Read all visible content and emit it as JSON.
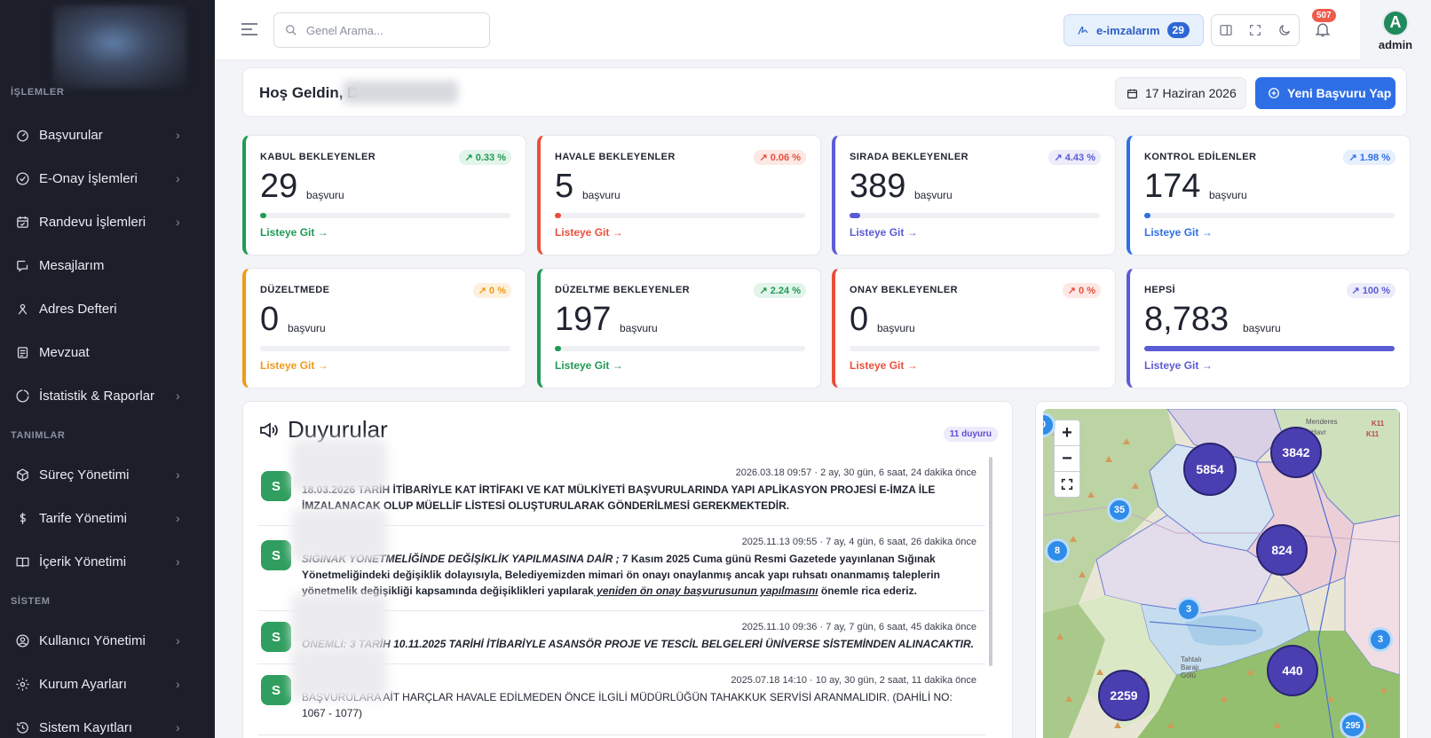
{
  "sidebar": {
    "sections": [
      "İŞLEMLER",
      "TANIMLAR",
      "SİSTEM"
    ],
    "items": [
      {
        "label": "Başvurular",
        "icon": "gauge-icon"
      },
      {
        "label": "E-Onay İşlemleri",
        "icon": "check-circle-icon"
      },
      {
        "label": "Randevu İşlemleri",
        "icon": "calendar-check-icon"
      },
      {
        "label": "Mesajlarım",
        "icon": "message-icon"
      },
      {
        "label": "Adres Defteri",
        "icon": "address-book-icon"
      },
      {
        "label": "Mevzuat",
        "icon": "document-icon"
      },
      {
        "label": "İstatistik & Raporlar",
        "icon": "chart-ring-icon"
      },
      {
        "label": "Süreç Yönetimi",
        "icon": "cube-icon"
      },
      {
        "label": "Tarife Yönetimi",
        "icon": "dollar-icon"
      },
      {
        "label": "İçerik Yönetimi",
        "icon": "book-icon"
      },
      {
        "label": "Kullanıcı Yönetimi",
        "icon": "user-circle-icon"
      },
      {
        "label": "Kurum Ayarları",
        "icon": "gear-icon"
      },
      {
        "label": "Sistem Kayıtları",
        "icon": "history-icon"
      }
    ]
  },
  "topbar": {
    "search_placeholder": "Genel Arama...",
    "eimza_label": "e-imzalarım",
    "eimza_count": "29",
    "notif_count": "507",
    "avatar_letter": "A",
    "user_name": "admin"
  },
  "welcome": {
    "greeting": "Hoş Geldin, B",
    "date": "17 Haziran 2026",
    "new_button": "Yeni Başvuru Yap"
  },
  "stats": [
    {
      "title": "KABUL BEKLEYENLER",
      "value": "29",
      "unit": "başvuru",
      "change": "0.33 %",
      "progress": 0.0033,
      "link": "Listeye Git",
      "color": "#1f9a55",
      "badge_bg": "#e3f5ea"
    },
    {
      "title": "HAVALE BEKLEYENLER",
      "value": "5",
      "unit": "başvuru",
      "change": "0.06 %",
      "progress": 0.0006,
      "link": "Listeye Git",
      "color": "#ea4f3c",
      "badge_bg": "#fde8e5"
    },
    {
      "title": "SIRADA BEKLEYENLER",
      "value": "389",
      "unit": "başvuru",
      "change": "4.43 %",
      "progress": 0.0443,
      "link": "Listeye Git",
      "color": "#5b5bd6",
      "badge_bg": "#ececfb"
    },
    {
      "title": "KONTROL EDİLENLER",
      "value": "174",
      "unit": "başvuru",
      "change": "1.98 %",
      "progress": 0.0198,
      "link": "Listeye Git",
      "color": "#2f6fe6",
      "badge_bg": "#e6effd"
    },
    {
      "title": "DÜZELTMEDE",
      "value": "0",
      "unit": "başvuru",
      "change": "0 %",
      "progress": 0,
      "link": "Listeye Git",
      "color": "#ef9a1a",
      "badge_bg": "#fdf1de"
    },
    {
      "title": "DÜZELTME BEKLEYENLER",
      "value": "197",
      "unit": "başvuru",
      "change": "2.24 %",
      "progress": 0.0224,
      "link": "Listeye Git",
      "color": "#1f9a55",
      "badge_bg": "#e3f5ea"
    },
    {
      "title": "ONAY BEKLEYENLER",
      "value": "0",
      "unit": "başvuru",
      "change": "0 %",
      "progress": 0,
      "link": "Listeye Git",
      "color": "#ea4f3c",
      "badge_bg": "#fde8e5"
    },
    {
      "title": "HEPSİ",
      "value": "8,783",
      "unit": "başvuru",
      "change": "100 %",
      "progress": 1,
      "link": "Listeye Git",
      "color": "#5b5bd6",
      "badge_bg": "#ececfb"
    }
  ],
  "announcements": {
    "title": "Duyurular",
    "count_label": "11 duyuru",
    "items": [
      {
        "avatar": "S",
        "time": "2026.03.18 09:57 · 2 ay, 30 gün, 6 saat, 24 dakika önce",
        "text": "18.03.2026 TARİH İTİBARİYLE KAT İRTİFAKI VE KAT MÜLKİYETİ BAŞVURULARINDA YAPI APLİKASYON PROJESİ E-İMZA İLE İMZALANACAK OLUP MÜELLİF LİSTESİ OLUŞTURULARAK GÖNDERİLMESİ GEREKMEKTEDİR."
      },
      {
        "avatar": "S",
        "time": "2025.11.13 09:55 · 7 ay, 4 gün, 6 saat, 26 dakika önce",
        "text_italic": "SIĞINAK YÖNETMELİĞİNDE DEĞİŞİKLİK YAPILMASINA DAİR ;",
        "text": " 7 Kasım 2025 Cuma günü Resmi Gazetede yayınlanan Sığınak Yönetmeliğindeki değişiklik dolayısıyla, Belediyemizden mimari ön onayı onaylanmış ancak yapı ruhsatı onanmamış taleplerin yönetmelik değişikliği kapsamında değişiklikleri yapılarak",
        "text_underline": " yeniden ön onay başvurusunun yapılmasını",
        "text_end": " önemle rica ederiz."
      },
      {
        "avatar": "S",
        "time": "2025.11.10 09:36 · 7 ay, 7 gün, 6 saat, 45 dakika önce",
        "text_italic": "ÖNEMLİ: 3 TARİH 10.11.2025 TARİHİ İTİBARİYLE ASANSÖR PROJE VE TESCİL BELGELERİ ÜNİVERSE SİSTEMİNDEN ALINACAKTIR."
      },
      {
        "avatar": "S",
        "time": "2025.07.18 14:10 · 10 ay, 30 gün, 2 saat, 11 dakika önce",
        "text": "BAŞVURULARA AİT HARÇLAR HAVALE EDİLMEDEN ÖNCE İLGİLİ MÜDÜRLÜĞÜN TAHAKKUK SERVİSİ ARANMALIDIR. (DAHİLİ NO: 1067 - 1077)"
      }
    ]
  },
  "map": {
    "zoom_in": "+",
    "zoom_out": "−",
    "labels": [
      "Menderes",
      "Havr",
      "Tahtalı Barajı Gölü",
      "K11",
      "K11"
    ],
    "clusters": [
      {
        "label": "5854",
        "size": "large"
      },
      {
        "label": "3842",
        "size": "large"
      },
      {
        "label": "824",
        "size": "large"
      },
      {
        "label": "440",
        "size": "large"
      },
      {
        "label": "2259",
        "size": "large"
      },
      {
        "label": "35",
        "size": "small"
      },
      {
        "label": "8",
        "size": "small"
      },
      {
        "label": "3",
        "size": "small"
      },
      {
        "label": "3",
        "size": "small"
      },
      {
        "label": "295",
        "size": "small"
      },
      {
        "label": "0",
        "size": "small"
      }
    ]
  }
}
